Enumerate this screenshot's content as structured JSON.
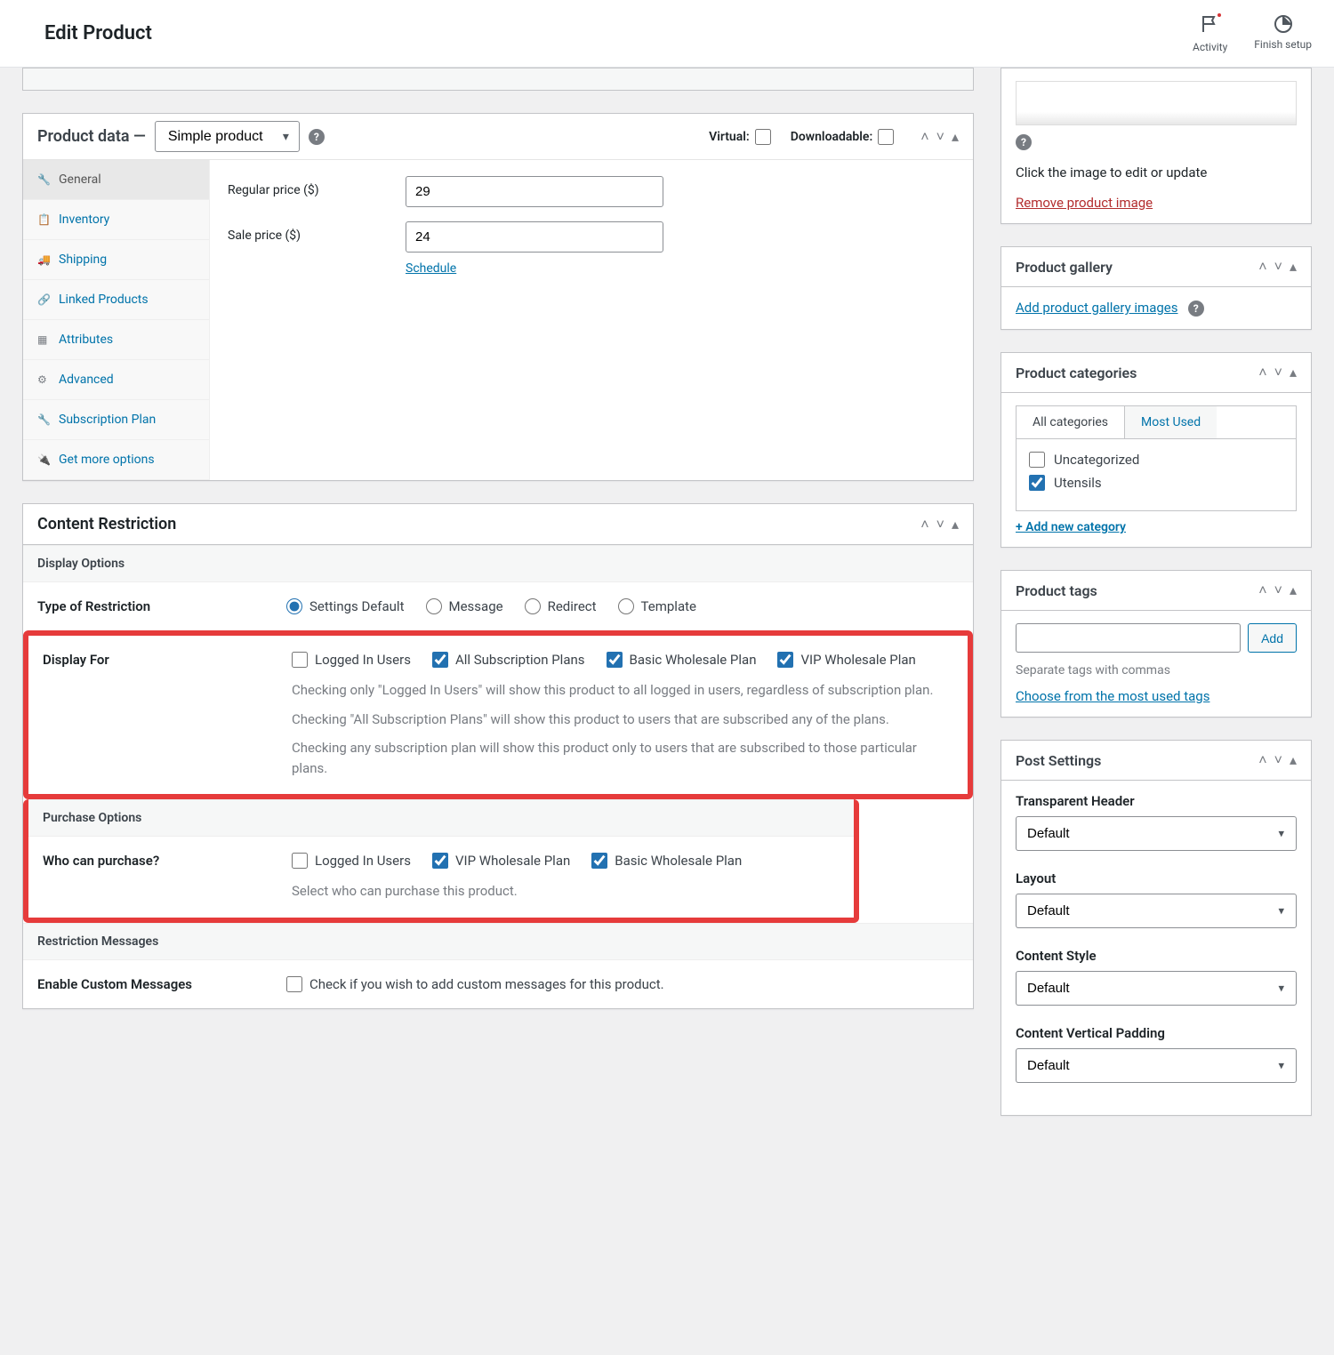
{
  "header": {
    "title": "Edit Product",
    "activity": "Activity",
    "finish": "Finish setup"
  },
  "word_count_bar": {
    "left": "",
    "right": ""
  },
  "product_data": {
    "title": "Product data —",
    "type": "Simple product",
    "virtual_label": "Virtual:",
    "downloadable_label": "Downloadable:",
    "tabs": {
      "general": "General",
      "inventory": "Inventory",
      "shipping": "Shipping",
      "linked": "Linked Products",
      "attributes": "Attributes",
      "advanced": "Advanced",
      "subscription": "Subscription Plan",
      "getmore": "Get more options"
    },
    "general": {
      "regular_price_label": "Regular price ($)",
      "regular_price_value": "29",
      "sale_price_label": "Sale price ($)",
      "sale_price_value": "24",
      "schedule": "Schedule"
    }
  },
  "content_restriction": {
    "title": "Content Restriction",
    "display_options": "Display Options",
    "type_label": "Type of Restriction",
    "type_options": {
      "default": "Settings Default",
      "message": "Message",
      "redirect": "Redirect",
      "template": "Template"
    },
    "display_for_label": "Display For",
    "display_for_options": {
      "logged_in": "Logged In Users",
      "all_plans": "All Subscription Plans",
      "basic": "Basic Wholesale Plan",
      "vip": "VIP Wholesale Plan"
    },
    "display_help1": "Checking only \"Logged In Users\" will show this product to all logged in users, regardless of subscription plan.",
    "display_help2": "Checking \"All Subscription Plans\" will show this product to users that are subscribed any of the plans.",
    "display_help3": "Checking any subscription plan will show this product only to users that are subscribed to those particular plans.",
    "purchase_options": "Purchase Options",
    "who_can_purchase_label": "Who can purchase?",
    "purchase_options_opts": {
      "logged_in": "Logged In Users",
      "vip": "VIP Wholesale Plan",
      "basic": "Basic Wholesale Plan"
    },
    "purchase_help": "Select who can purchase this product.",
    "restriction_messages": "Restriction Messages",
    "enable_custom_label": "Enable Custom Messages",
    "enable_custom_check": "Check if you wish to add custom messages for this product."
  },
  "sidebar": {
    "image": {
      "edit_text": "Click the image to edit or update",
      "remove": "Remove product image"
    },
    "gallery": {
      "title": "Product gallery",
      "add": "Add product gallery images"
    },
    "categories": {
      "title": "Product categories",
      "all_tab": "All categories",
      "most_used": "Most Used",
      "uncategorized": "Uncategorized",
      "utensils": "Utensils",
      "add_new": "+ Add new category"
    },
    "tags": {
      "title": "Product tags",
      "add_btn": "Add",
      "desc": "Separate tags with commas",
      "choose": "Choose from the most used tags"
    },
    "post_settings": {
      "title": "Post Settings",
      "transparent_header": "Transparent Header",
      "layout": "Layout",
      "content_style": "Content Style",
      "vertical_padding": "Content Vertical Padding",
      "default": "Default"
    }
  }
}
